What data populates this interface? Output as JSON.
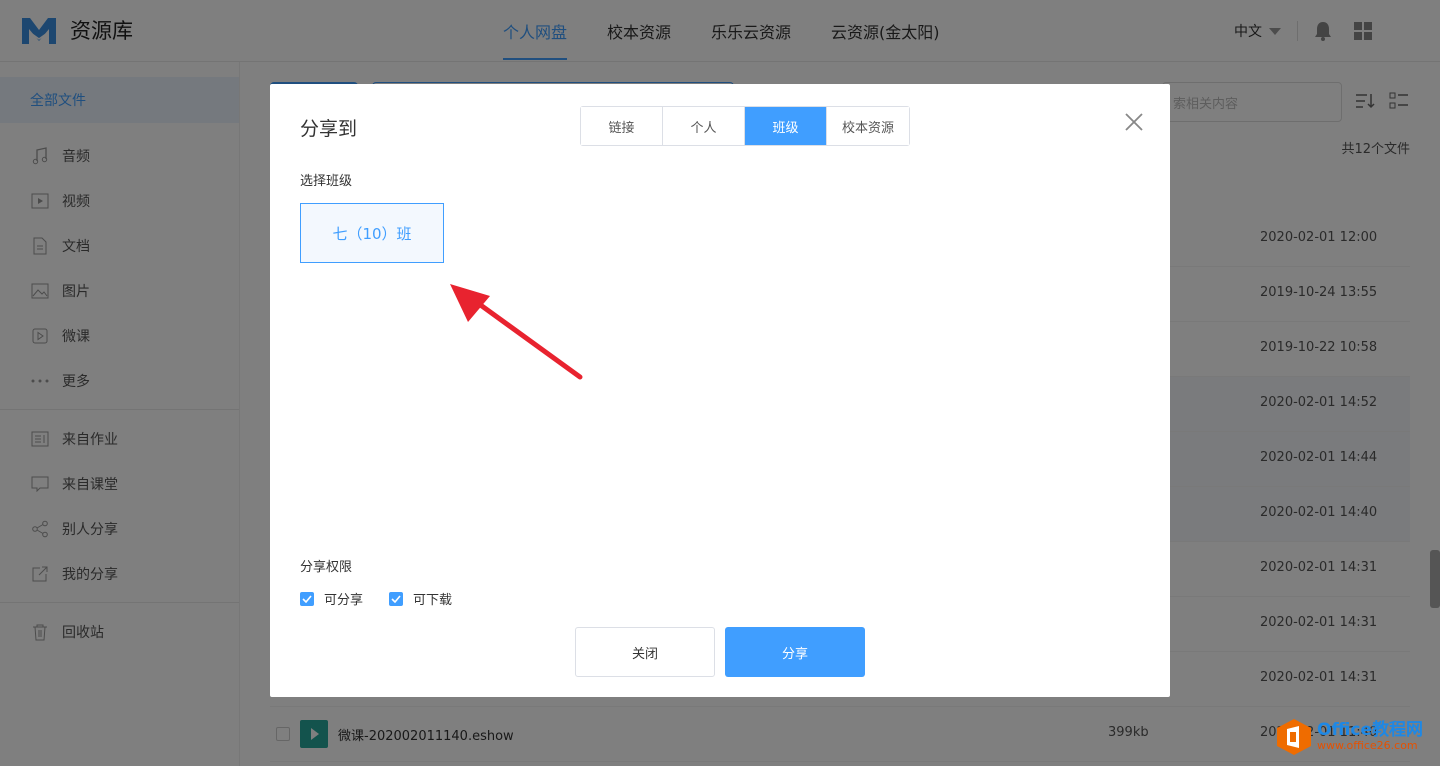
{
  "app": {
    "title": "资源库"
  },
  "nav": [
    {
      "label": "个人网盘",
      "active": true
    },
    {
      "label": "校本资源",
      "active": false
    },
    {
      "label": "乐乐云资源",
      "active": false
    },
    {
      "label": "云资源(金太阳)",
      "active": false
    }
  ],
  "header": {
    "language": "中文"
  },
  "sidebar": {
    "all_files": "全部文件",
    "group1": [
      {
        "label": "音频",
        "icon": "music-icon"
      },
      {
        "label": "视频",
        "icon": "video-icon"
      },
      {
        "label": "文档",
        "icon": "document-icon"
      },
      {
        "label": "图片",
        "icon": "image-icon"
      },
      {
        "label": "微课",
        "icon": "play-icon"
      },
      {
        "label": "更多",
        "icon": "more-icon"
      }
    ],
    "group2": [
      {
        "label": "来自作业",
        "icon": "homework-icon"
      },
      {
        "label": "来自课堂",
        "icon": "classroom-icon"
      },
      {
        "label": "别人分享",
        "icon": "share-icon"
      },
      {
        "label": "我的分享",
        "icon": "my-share-icon"
      }
    ],
    "group3": [
      {
        "label": "回收站",
        "icon": "trash-icon"
      }
    ]
  },
  "main": {
    "search_placeholder": "索相关内容",
    "file_count": "共12个文件",
    "rows": [
      {
        "date": "2020-02-01 12:00"
      },
      {
        "date": "2019-10-24 13:55"
      },
      {
        "date": "2019-10-22 10:58"
      },
      {
        "date": "2020-02-01 14:52"
      },
      {
        "date": "2020-02-01 14:44"
      },
      {
        "date": "2020-02-01 14:40"
      },
      {
        "date": "2020-02-01 14:31"
      },
      {
        "date": "2020-02-01 14:31"
      },
      {
        "date": "2020-02-01 14:31"
      },
      {
        "name": "微课-202002011140.eshow",
        "size": "399kb",
        "date": "2020-02-01 11:40"
      }
    ]
  },
  "modal": {
    "title": "分享到",
    "tabs": [
      {
        "label": "链接",
        "active": false
      },
      {
        "label": "个人",
        "active": false
      },
      {
        "label": "班级",
        "active": true
      },
      {
        "label": "校本资源",
        "active": false
      }
    ],
    "select_class_label": "选择班级",
    "class_name": "七（10）班",
    "permission_label": "分享权限",
    "permissions": [
      {
        "label": "可分享",
        "checked": true
      },
      {
        "label": "可下载",
        "checked": true
      }
    ],
    "close_button": "关闭",
    "share_button": "分享"
  },
  "watermark": {
    "line1": "Office教程网",
    "line2": "www.office26.com"
  },
  "colors": {
    "accent": "#409eff",
    "annotation_arrow": "#e8232f"
  }
}
